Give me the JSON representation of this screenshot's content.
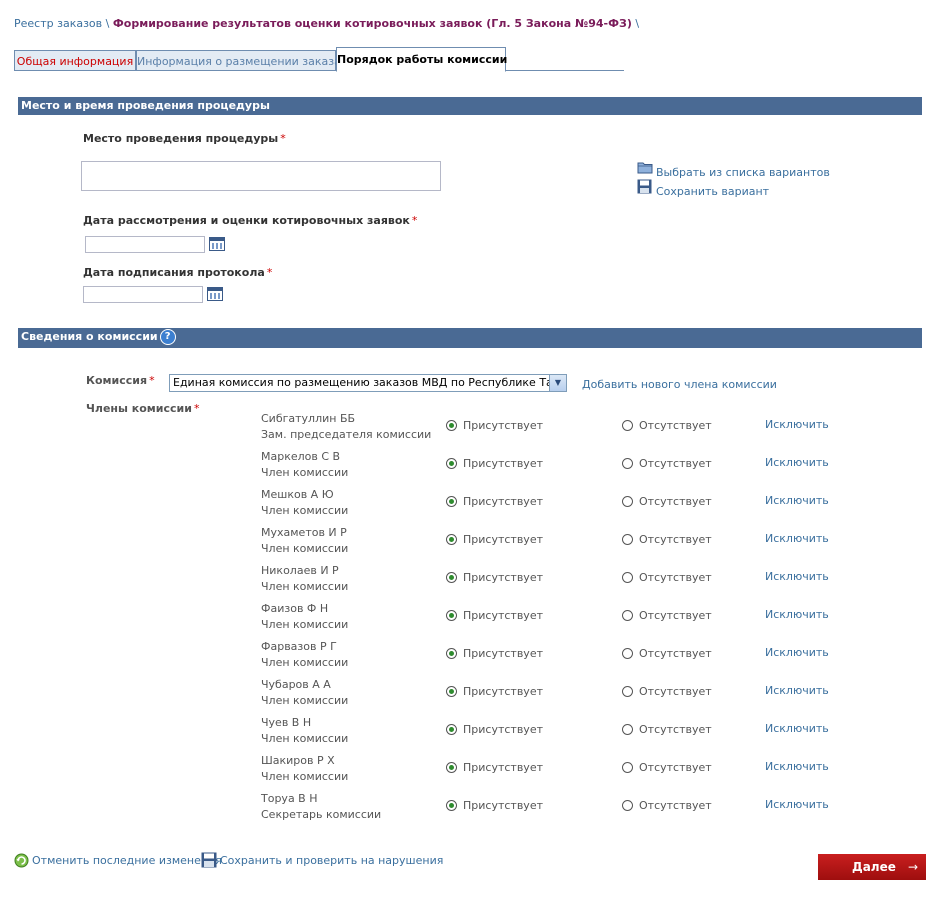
{
  "breadcrumb": {
    "root": "Реестр заказов",
    "separator": "\\",
    "current": "Формирование результатов оценки котировочных заявок (Гл. 5 Закона №94-ФЗ)",
    "trailing": "\\"
  },
  "tabs": [
    {
      "label": "Общая информация"
    },
    {
      "label": "Информация о размещении заказа"
    },
    {
      "label": "Порядок работы комиссии",
      "active": true
    }
  ],
  "section_place": {
    "header": "Место и время проведения процедуры",
    "place_label": "Место проведения процедуры",
    "place_value": "",
    "choose_link": "Выбрать из списка вариантов",
    "save_link": "Сохранить вариант",
    "review_date_label": "Дата рассмотрения и оценки котировочных заявок",
    "review_date_value": "",
    "sign_date_label": "Дата подписания протокола",
    "sign_date_value": "",
    "required_mark": "*"
  },
  "section_commission": {
    "header": "Сведения о комиссии",
    "help_symbol": "?",
    "commission_label": "Комиссия",
    "commission_selected": "Единая комиссия по размещению заказов МВД по Республике Татарстан",
    "add_member_link": "Добавить нового члена комиссии",
    "members_label": "Члены комиссии",
    "present_label": "Присутствует",
    "absent_label": "Отсутствует",
    "exclude_label": "Исключить",
    "members": [
      {
        "name": "Сибгатуллин ББ",
        "role": "Зам. председателя комиссии",
        "status": "present"
      },
      {
        "name": "Маркелов С В",
        "role": "Член комиссии",
        "status": "present"
      },
      {
        "name": "Мешков А Ю",
        "role": "Член комиссии",
        "status": "present"
      },
      {
        "name": "Мухаметов И Р",
        "role": "Член комиссии",
        "status": "present"
      },
      {
        "name": "Николаев И Р",
        "role": "Член комиссии",
        "status": "present"
      },
      {
        "name": "Фаизов Ф Н",
        "role": "Член комиссии",
        "status": "present"
      },
      {
        "name": "Фарвазов Р Г",
        "role": "Член комиссии",
        "status": "present"
      },
      {
        "name": "Чубаров А А",
        "role": "Член комиссии",
        "status": "present"
      },
      {
        "name": "Чуев В Н",
        "role": "Член комиссии",
        "status": "present"
      },
      {
        "name": "Шакиров Р Х",
        "role": "Член комиссии",
        "status": "present"
      },
      {
        "name": "Торуа В Н",
        "role": "Секретарь комиссии",
        "status": "present"
      }
    ]
  },
  "footer": {
    "undo_link": "Отменить последние изменения",
    "save_check_link": "Сохранить и проверить на нарушения",
    "next_button": "Далее",
    "next_arrow": "→"
  },
  "colors": {
    "section_header_bg": "#4a6a94",
    "link": "#3a6f9e",
    "required": "#cc0000",
    "next_button": "#b01414"
  }
}
